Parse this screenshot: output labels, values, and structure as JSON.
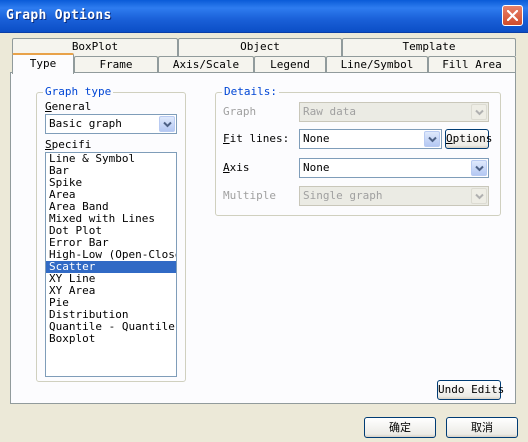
{
  "window": {
    "title": "Graph Options"
  },
  "tabs_back": [
    {
      "label": "BoxPlot"
    },
    {
      "label": "Object"
    },
    {
      "label": "Template"
    }
  ],
  "tabs_front": [
    {
      "label": "Type"
    },
    {
      "label": "Frame"
    },
    {
      "label": "Axis/Scale"
    },
    {
      "label": "Legend"
    },
    {
      "label": "Line/Symbol"
    },
    {
      "label": "Fill Area"
    }
  ],
  "active_tab": "Type",
  "graph_type": {
    "legend": "Graph type",
    "general_label": "General",
    "general_value": "Basic graph",
    "specific_label": "Specifi",
    "items": [
      "Line & Symbol",
      "Bar",
      "Spike",
      "Area",
      "Area Band",
      "Mixed with Lines",
      "Dot Plot",
      "Error Bar",
      "High-Low (Open-Close)",
      "Scatter",
      "XY Line",
      "XY Area",
      "Pie",
      "Distribution",
      "Quantile - Quantile",
      "Boxplot"
    ],
    "selected": "Scatter"
  },
  "details": {
    "legend": "Details:",
    "graph_label": "Graph",
    "graph_value": "Raw data",
    "fit_label": "Fit lines:",
    "fit_value": "None",
    "options_label": "Options",
    "axis_label": "Axis",
    "axis_value": "None",
    "multiple_label": "Multiple",
    "multiple_value": "Single graph"
  },
  "undo_label": "Undo Edits",
  "ok_label": "确定",
  "cancel_label": "取消",
  "colors": {
    "titlebar": "#0a5bd8",
    "selection": "#316ac5",
    "groupbox_title": "#0046d5"
  }
}
